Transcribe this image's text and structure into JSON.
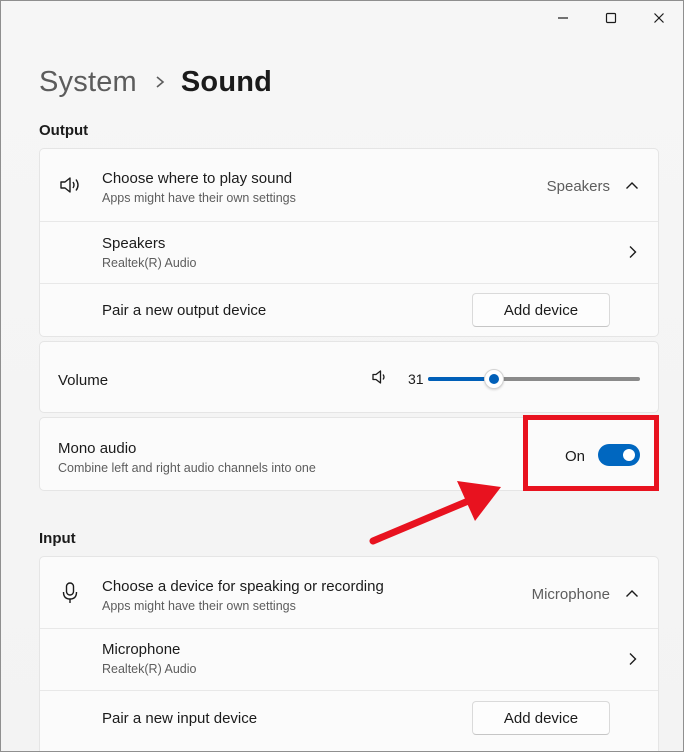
{
  "window": {
    "controls": {
      "minimize": "minimize-icon",
      "maximize": "maximize-icon",
      "close": "close-icon"
    }
  },
  "breadcrumb": {
    "parent": "System",
    "current": "Sound"
  },
  "output": {
    "section_title": "Output",
    "choose": {
      "title": "Choose where to play sound",
      "subtitle": "Apps might have their own settings",
      "value": "Speakers",
      "icon": "speaker-icon"
    },
    "device": {
      "title": "Speakers",
      "subtitle": "Realtek(R) Audio"
    },
    "pair": {
      "title": "Pair a new output device",
      "button": "Add device"
    }
  },
  "volume": {
    "label": "Volume",
    "value": "31",
    "level": 0.31,
    "icon": "volume-icon"
  },
  "mono": {
    "title": "Mono audio",
    "subtitle": "Combine left and right audio channels into one",
    "state_label": "On",
    "enabled": true
  },
  "input": {
    "section_title": "Input",
    "choose": {
      "title": "Choose a device for speaking or recording",
      "subtitle": "Apps might have their own settings",
      "value": "Microphone",
      "icon": "microphone-icon"
    },
    "device": {
      "title": "Microphone",
      "subtitle": "Realtek(R) Audio"
    },
    "pair": {
      "title": "Pair a new input device",
      "button": "Add device"
    }
  },
  "colors": {
    "accent": "#0067c0",
    "annotation": "#e8121f"
  }
}
